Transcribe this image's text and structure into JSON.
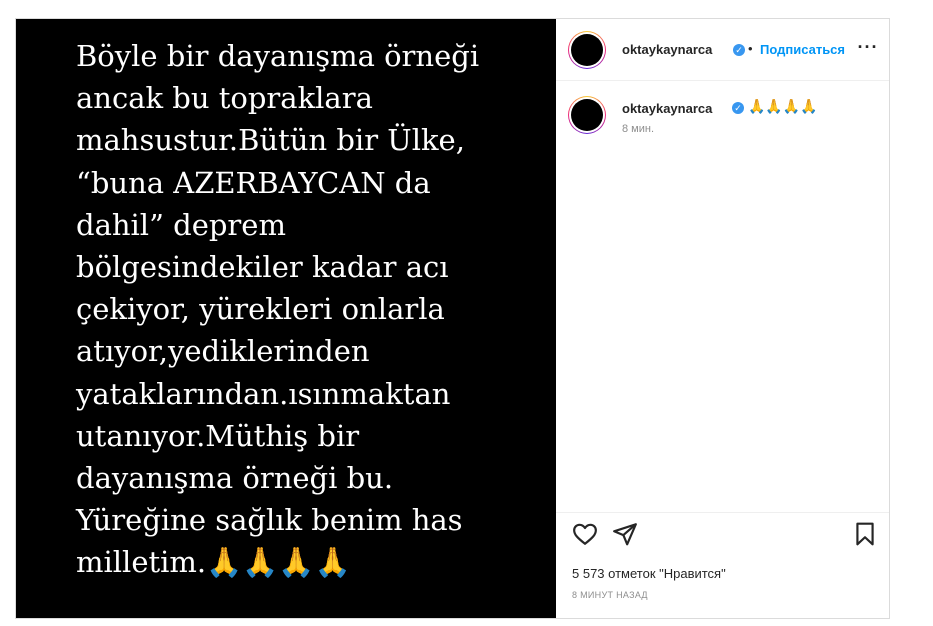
{
  "post": {
    "media_text_lines": [
      "Böyle bir dayanışma örneği",
      "ancak bu topraklara",
      "mahsustur.Bütün bir Ülke,",
      "“buna AZERBAYCAN da",
      "dahil”  deprem",
      "bölgesindekiler kadar acı",
      "çekiyor, yürekleri onlarla",
      "atıyor,yediklerinden",
      "yataklarından.ısınmaktan",
      "utanıyor.Müthiş bir",
      "dayanışma örneği bu.",
      "Yüreğine sağlık benim has",
      "milletim."
    ],
    "media_emoji": "🙏🙏🙏🙏"
  },
  "header": {
    "username": "oktaykaynarca",
    "dot": "•",
    "follow_label": "Подписаться",
    "more_icon": "more-horizontal-icon"
  },
  "comment": {
    "username": "oktaykaynarca",
    "caption": "🙏🙏🙏🙏",
    "time_ago": "8 мин."
  },
  "actions": {
    "like_icon": "heart-icon",
    "share_icon": "send-icon",
    "save_icon": "bookmark-icon"
  },
  "likes_text": "5 573 отметок \"Нравится\"",
  "posted_ago": "8 МИНУТ НАЗАД",
  "colors": {
    "accent": "#0095f6",
    "verified": "#3897f0",
    "media_bg": "#000000",
    "border": "#dbdbdb"
  }
}
